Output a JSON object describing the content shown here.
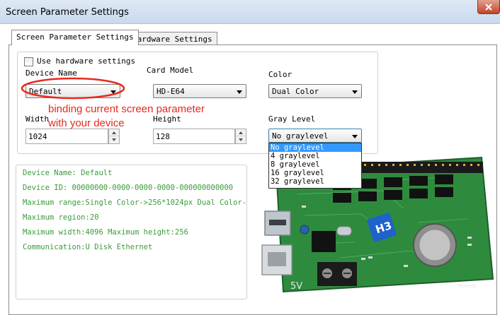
{
  "window": {
    "title": "Screen Parameter Settings",
    "close_label": "x"
  },
  "tabs": [
    {
      "label": "Screen Parameter Settings",
      "active": true
    },
    {
      "label": "Hardware Settings",
      "active": false
    }
  ],
  "form": {
    "use_hardware_settings": "Use hardware settings",
    "device_name_label": "Device Name",
    "device_name_value": "Default",
    "card_model_label": "Card Model",
    "card_model_value": "HD-E64",
    "color_label": "Color",
    "color_value": "Dual Color",
    "width_label": "Width",
    "width_value": "1024",
    "height_label": "Height",
    "height_value": "128",
    "gray_level_label": "Gray Level",
    "gray_level_value": "No graylevel",
    "gray_level_options": [
      "No graylevel",
      "4 graylevel",
      "8 graylevel",
      "16 graylevel",
      "32 graylevel"
    ]
  },
  "info": {
    "lines": [
      "Device Name: Default",
      "Device ID:  00000000-0000-0000-0000-000000000000",
      "Maximum range:Single Color->256*1024px  Dual Color-",
      "Maximum region:20",
      "Maximum width:4096 Maximum height:256",
      "Communication:U Disk  Ethernet"
    ]
  },
  "annotation": {
    "line1": "binding current screen parameter",
    "line2": "with your device",
    "color": "#e8281e"
  },
  "board": {
    "badge": "H3",
    "terminal_label": "5V",
    "corner_label": "Remote"
  },
  "colors": {
    "info_text": "#3d9a3d",
    "selection": "#3399ff",
    "board_green": "#2e8b3e"
  }
}
